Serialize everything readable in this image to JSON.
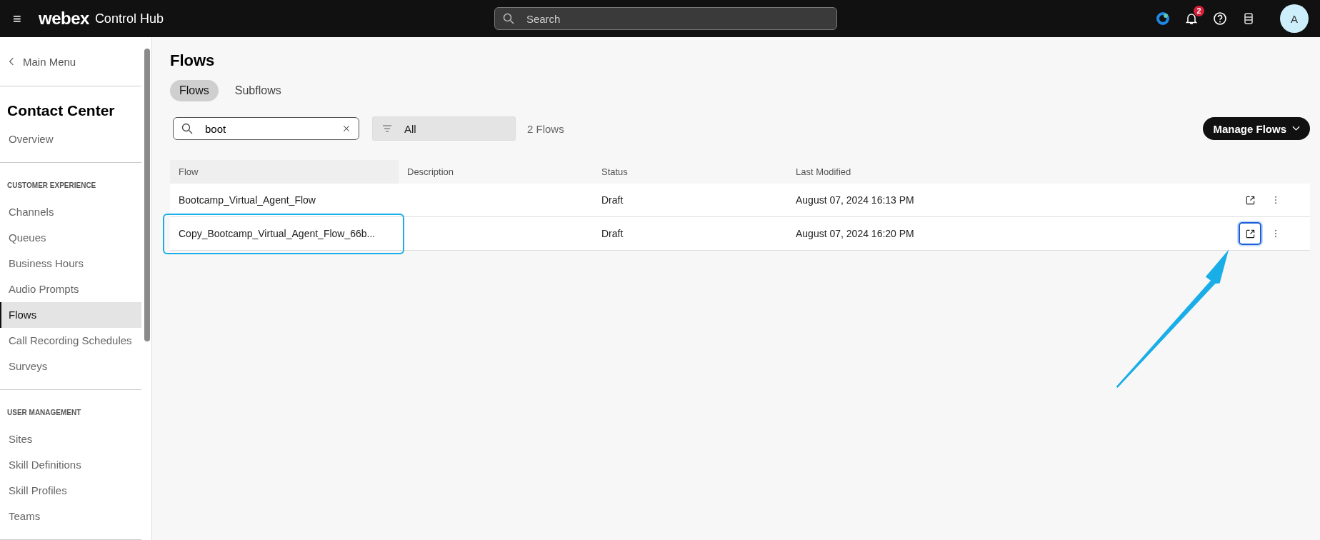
{
  "top_bar": {
    "menu_icon": "≡",
    "brand": "webex",
    "product": "Control Hub",
    "search": {
      "placeholder": "Search"
    },
    "notification_count": "2",
    "avatar": "A"
  },
  "sidebar": {
    "back": "Main Menu",
    "title": "Contact Center",
    "sections": [
      {
        "items": [
          {
            "label": "Overview",
            "selected": false
          }
        ]
      },
      {
        "heading": "CUSTOMER EXPERIENCE",
        "items": [
          {
            "label": "Channels",
            "selected": false
          },
          {
            "label": "Queues",
            "selected": false
          },
          {
            "label": "Business Hours",
            "selected": false
          },
          {
            "label": "Audio Prompts",
            "selected": false
          },
          {
            "label": "Flows",
            "selected": true
          },
          {
            "label": "Call Recording Schedules",
            "selected": false
          },
          {
            "label": "Surveys",
            "selected": false
          }
        ]
      },
      {
        "heading": "USER MANAGEMENT",
        "items": [
          {
            "label": "Sites",
            "selected": false
          },
          {
            "label": "Skill Definitions",
            "selected": false
          },
          {
            "label": "Skill Profiles",
            "selected": false
          },
          {
            "label": "Teams",
            "selected": false
          }
        ]
      }
    ]
  },
  "page": {
    "title": "Flows",
    "tabs": [
      {
        "label": "Flows",
        "selected": true
      },
      {
        "label": "Subflows",
        "selected": false
      }
    ],
    "search": {
      "value": "boot"
    },
    "filter": {
      "value": "All"
    },
    "count": "2 Flows",
    "manage_button": "Manage Flows",
    "table": {
      "columns": [
        "Flow",
        "Description",
        "Status",
        "Last Modified"
      ],
      "rows": [
        {
          "flow": "Bootcamp_Virtual_Agent_Flow",
          "description": "",
          "status": "Draft",
          "last_modified": "August 07, 2024 16:13 PM",
          "highlighted": false,
          "open_focused": false
        },
        {
          "flow": "Copy_Bootcamp_Virtual_Agent_Flow_66b...",
          "description": "",
          "status": "Draft",
          "last_modified": "August 07, 2024 16:20 PM",
          "highlighted": true,
          "open_focused": true
        }
      ]
    }
  }
}
